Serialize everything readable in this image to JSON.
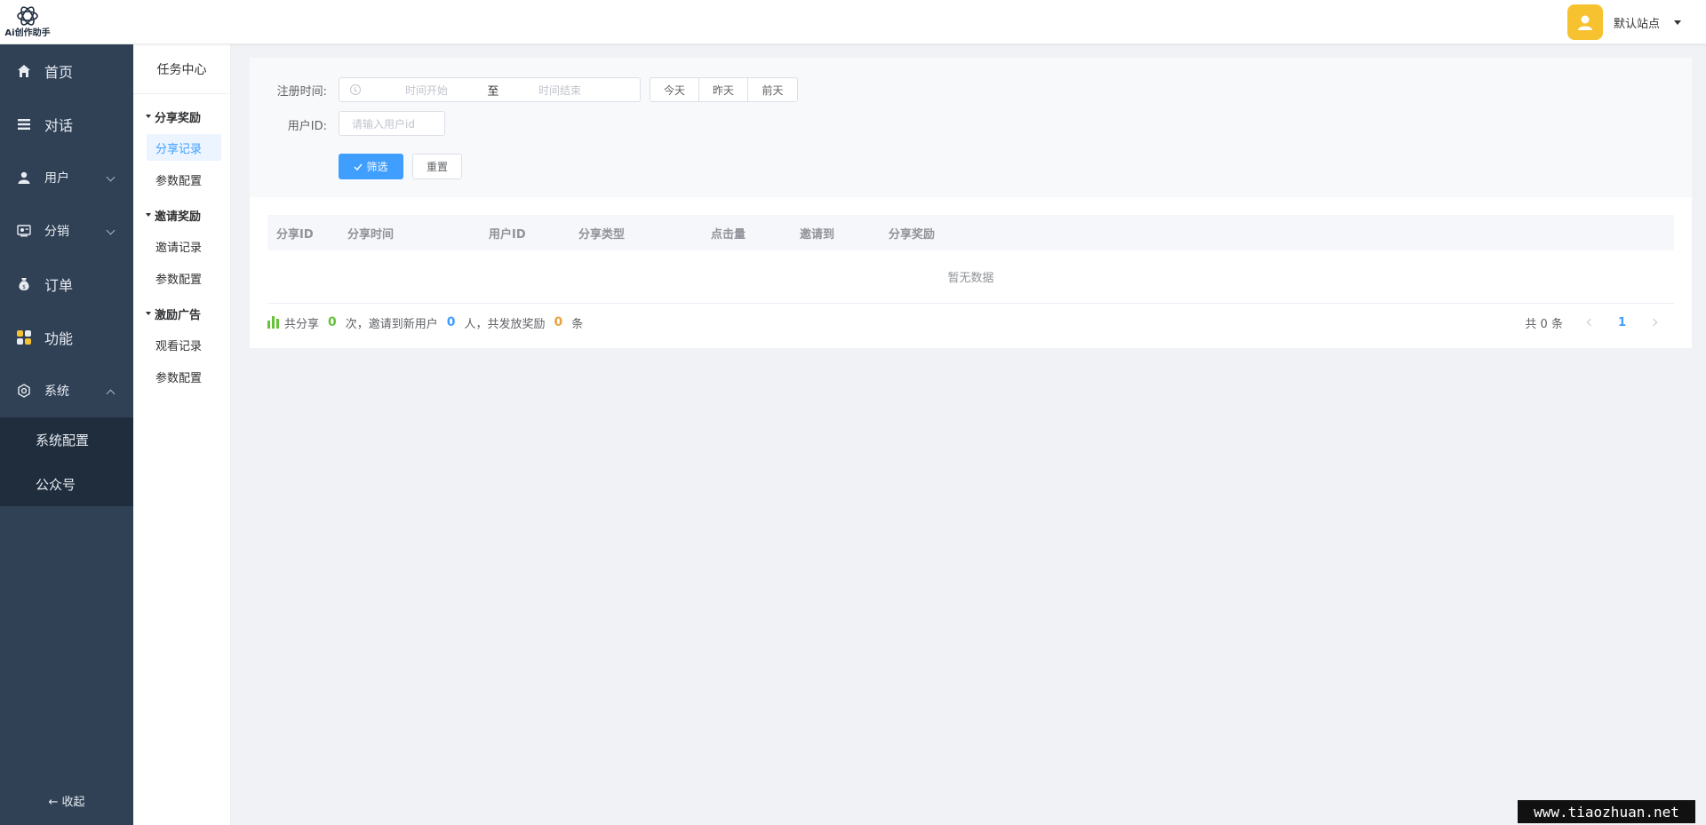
{
  "header": {
    "logo_text": "Ai创作助手",
    "site_name": "默认站点"
  },
  "sidebar": {
    "items": [
      {
        "label": "首页",
        "icon": "home-icon"
      },
      {
        "label": "对话",
        "icon": "list-icon"
      },
      {
        "label": "用户",
        "icon": "user-icon"
      },
      {
        "label": "分销",
        "icon": "distribution-icon"
      },
      {
        "label": "订单",
        "icon": "money-bag-icon"
      },
      {
        "label": "功能",
        "icon": "grid-icon"
      },
      {
        "label": "系统",
        "icon": "gear-icon"
      }
    ],
    "sub_items": [
      "系统配置",
      "公众号"
    ],
    "collapse_label": "← 收起"
  },
  "sub_sidebar": {
    "title": "任务中心",
    "groups": [
      {
        "label": "分享奖励",
        "links": [
          "分享记录",
          "参数配置"
        ]
      },
      {
        "label": "邀请奖励",
        "links": [
          "邀请记录",
          "参数配置"
        ]
      },
      {
        "label": "激励广告",
        "links": [
          "观看记录",
          "参数配置"
        ]
      }
    ]
  },
  "filters": {
    "reg_time_label": "注册时间:",
    "start_placeholder": "时间开始",
    "separator": "至",
    "end_placeholder": "时间结束",
    "quick": [
      "今天",
      "昨天",
      "前天"
    ],
    "uid_label": "用户ID:",
    "uid_placeholder": "请输入用户id",
    "filter_button": "筛选",
    "reset_button": "重置"
  },
  "table": {
    "columns": [
      "分享ID",
      "分享时间",
      "用户ID",
      "分享类型",
      "点击量",
      "邀请到",
      "分享奖励"
    ],
    "empty_text": "暂无数据"
  },
  "summary": {
    "p1": "共分享",
    "share_count": "0",
    "p2": "次，邀请到新用户",
    "invite_count": "0",
    "p3": "人，共发放奖励",
    "reward_count": "0",
    "p4": "条"
  },
  "pagination": {
    "total": "共 0 条",
    "current_page": "1"
  },
  "watermark": "www.tiaozhuan.net",
  "colors": {
    "accent": "#409eff",
    "sidebar_bg": "#304156",
    "share_count": "#67c23a",
    "invite_count": "#409eff",
    "reward_count": "#e6a23c"
  }
}
